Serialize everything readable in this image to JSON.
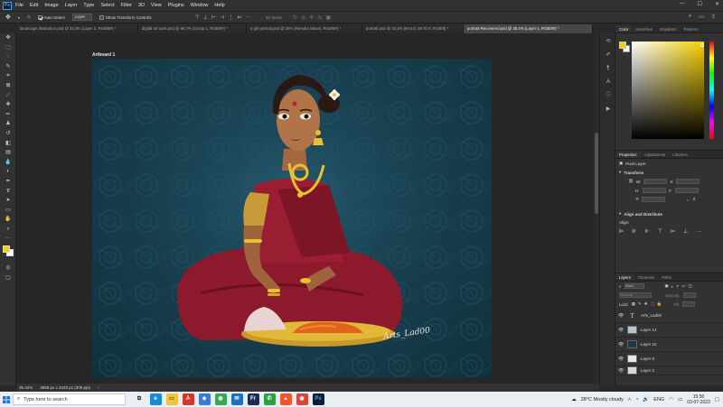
{
  "app": {
    "logo": "Ps",
    "menu": [
      "File",
      "Edit",
      "Image",
      "Layer",
      "Type",
      "Select",
      "Filter",
      "3D",
      "View",
      "Plugins",
      "Window",
      "Help"
    ],
    "window_controls": [
      "—",
      "☐",
      "✕"
    ]
  },
  "options": {
    "auto_select_label": "Auto-Select",
    "auto_select_target": "Layer",
    "transform_label": "Show Transform Controls",
    "mode_label": "3D Mode"
  },
  "tabs": [
    {
      "label": "landscape illustration.psd @ 33.3% (Layer 2, RGB/8#) *",
      "active": false
    },
    {
      "label": "digital art work.psd @ 66.7% (Group 1, RGB/8#) *",
      "active": false
    },
    {
      "label": "a girl portrait.psd @ 25% (Renuka Nikam, RGB/8#) *",
      "active": false
    },
    {
      "label": "portrait.psd @ 33.3% (BASIC SKTCH, RGB/8) *",
      "active": false
    },
    {
      "label": "portrait-Recovered.psd @ 35.4% (Layer 1, RGB/8#) *",
      "active": true
    }
  ],
  "canvas": {
    "artboard_label": "Artboard 1",
    "signature": "Arts_Lad00"
  },
  "status": {
    "zoom": "35.42%",
    "doc_size": "3858 px x 3433 px (300 ppi)"
  },
  "color_panel": {
    "tabs": [
      "Color",
      "Swatches",
      "Gradients",
      "Patterns"
    ],
    "fg": "#f5d000",
    "bg": "#ffffff"
  },
  "properties_panel": {
    "tabs": [
      "Properties",
      "Adjustments",
      "Libraries"
    ],
    "layer_kind": "Pixel Layer",
    "transform_label": "Transform",
    "align_label": "Align and Distribute",
    "align_sub": "Align:",
    "fields": [
      "W:",
      "H:",
      "X:",
      "Y:"
    ]
  },
  "layers_panel": {
    "tabs": [
      "Layers",
      "Channels",
      "Paths"
    ],
    "filter": "Kind",
    "blend_mode": "Normal",
    "opacity_label": "Opacity:",
    "lock_label": "Lock:",
    "fill_label": "Fill:",
    "layers": [
      {
        "name": "Arts_Lad00",
        "type": "text",
        "thumb": "#2d2d2d"
      },
      {
        "name": "Layer 14",
        "type": "pixel",
        "thumb": "#b6c5d2"
      },
      {
        "name": "Layer 15",
        "type": "pixel",
        "thumb": "#1a3a48"
      },
      {
        "name": "Layer 8",
        "type": "pixel",
        "thumb": "#e8e8e8"
      },
      {
        "name": "Layer 2",
        "type": "pixel",
        "thumb": "#d8d8d8"
      }
    ]
  },
  "taskbar": {
    "search_placeholder": "Type here to search",
    "apps": [
      {
        "name": "task-view",
        "glyph": "⧉",
        "color": "#333333",
        "bg": "#e9eef5"
      },
      {
        "name": "edge",
        "glyph": "e",
        "color": "#ffffff",
        "bg": "#1b8ad6"
      },
      {
        "name": "files",
        "glyph": "▭",
        "color": "#6b4a00",
        "bg": "#f2c33c"
      },
      {
        "name": "pdf",
        "glyph": "A",
        "color": "#ffffff",
        "bg": "#d8352a"
      },
      {
        "name": "photos",
        "glyph": "◈",
        "color": "#ffffff",
        "bg": "#3a7bd5"
      },
      {
        "name": "chrome",
        "glyph": "◉",
        "color": "#ffffff",
        "bg": "#34a853"
      },
      {
        "name": "mail",
        "glyph": "✉",
        "color": "#ffffff",
        "bg": "#1f6fbf"
      },
      {
        "name": "fresco",
        "glyph": "Fr",
        "color": "#ffffff",
        "bg": "#1c2f52"
      },
      {
        "name": "phone",
        "glyph": "✆",
        "color": "#ffffff",
        "bg": "#2ea043"
      },
      {
        "name": "brave",
        "glyph": "▲",
        "color": "#ffffff",
        "bg": "#fb542b"
      },
      {
        "name": "chrome2",
        "glyph": "◉",
        "color": "#ffffff",
        "bg": "#db4437"
      },
      {
        "name": "photoshop",
        "glyph": "Ps",
        "color": "#31a8ff",
        "bg": "#0e1d33"
      }
    ],
    "weather": "28°C  Mostly cloudy",
    "lang": "ENG",
    "time": "15:50",
    "date": "03-07-2023"
  }
}
